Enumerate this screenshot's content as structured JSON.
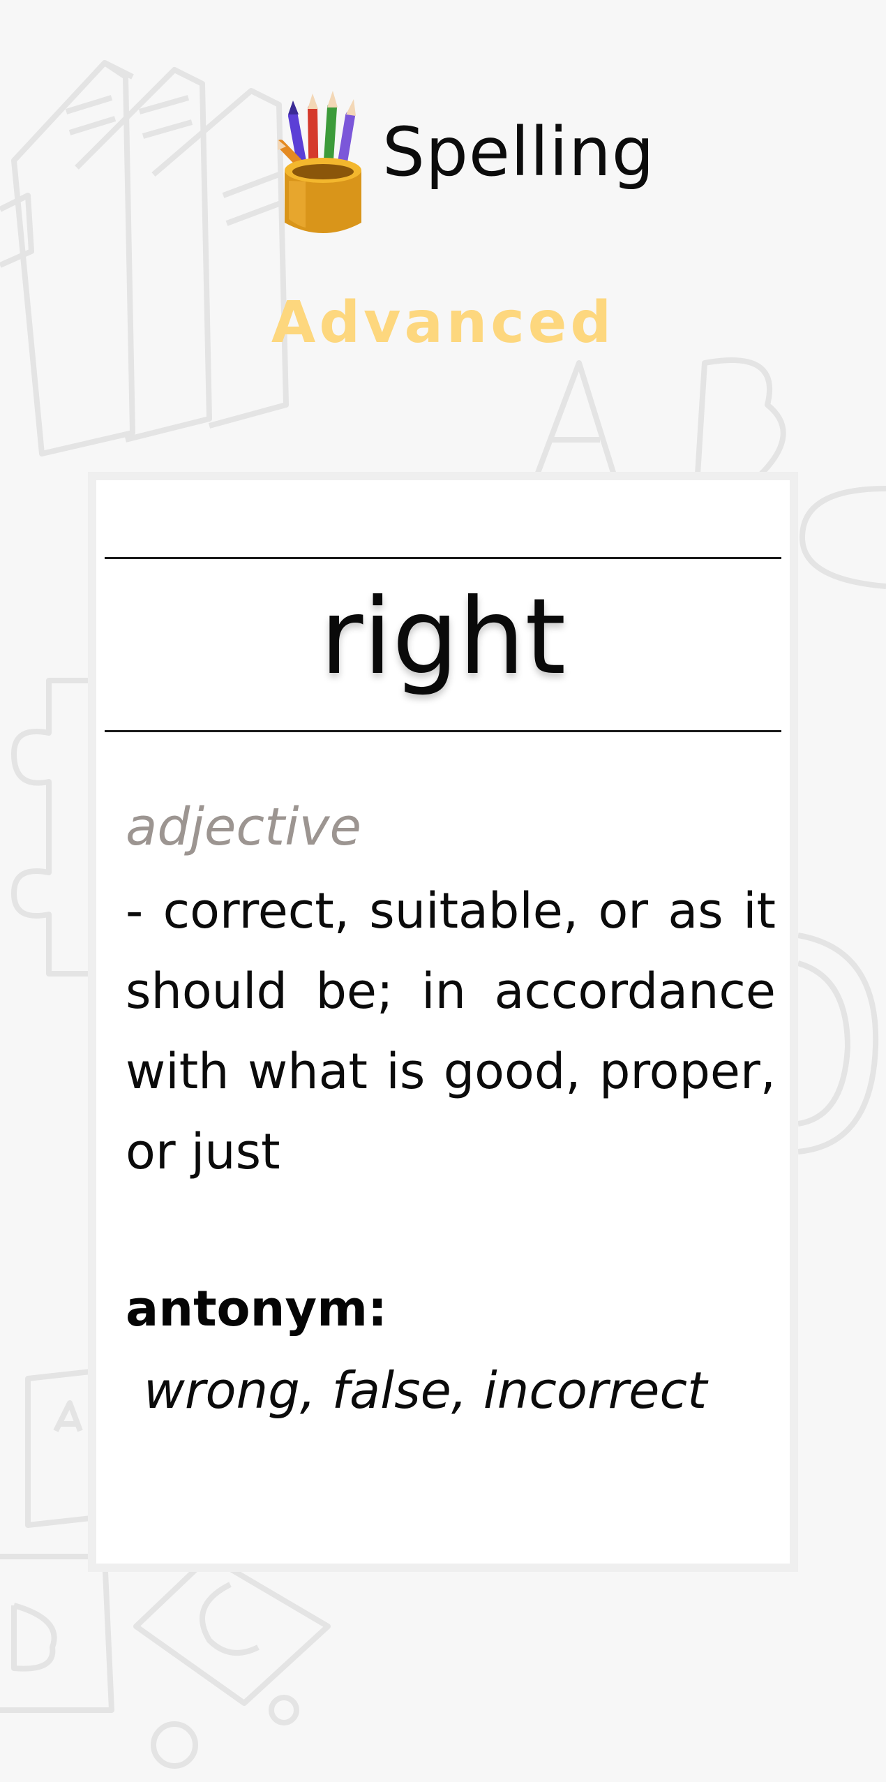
{
  "header": {
    "title": "Spelling",
    "icon": "pencil-cup-icon"
  },
  "level": {
    "label": "Advanced",
    "color": "#fdd77e"
  },
  "card": {
    "word": "right",
    "part_of_speech": "adjective",
    "definition": " - correct, suitable, or as it should be; in accordance with what is good, proper, or just",
    "antonym_label": "antonym:",
    "antonyms": "wrong, false, incorrect"
  },
  "colors": {
    "background": "#f7f7f7",
    "card": "#ffffff",
    "card_border": "#efefef",
    "text": "#0b0b0b",
    "part_of_speech": "#9c9591"
  }
}
